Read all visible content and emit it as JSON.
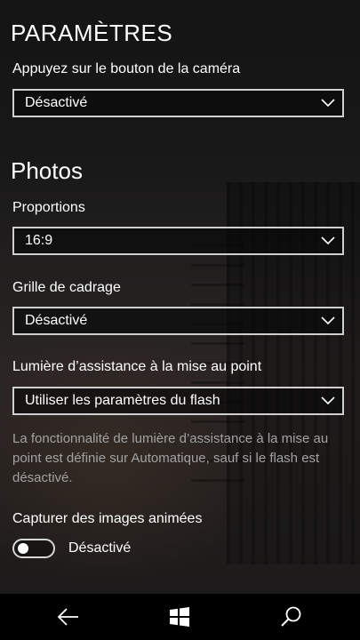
{
  "header": {
    "title": "PARAMÈTRES"
  },
  "settings": {
    "camera_button": {
      "label": "Appuyez sur le bouton de la caméra",
      "value": "Désactivé"
    },
    "photos_section_title": "Photos",
    "aspect_ratio": {
      "label": "Proportions",
      "value": "16:9"
    },
    "framing_grid": {
      "label": "Grille de cadrage",
      "value": "Désactivé"
    },
    "focus_assist_light": {
      "label": "Lumière d’assistance à la mise au point",
      "value": "Utiliser les paramètres du flash",
      "help": "La fonctionnalité de lumière d’assistance à la mise au point est définie sur Automatique, sauf si le flash est désactivé."
    },
    "living_images": {
      "label": "Capturer des images animées",
      "state": "Désactivé",
      "on": false
    }
  },
  "navbar": {
    "icons": [
      "back-arrow-icon",
      "windows-start-icon",
      "search-icon"
    ]
  },
  "colors": {
    "text": "#ffffff",
    "help_text": "#a2a2a2",
    "border": "#cfcfcf",
    "navbar": "#000000"
  }
}
